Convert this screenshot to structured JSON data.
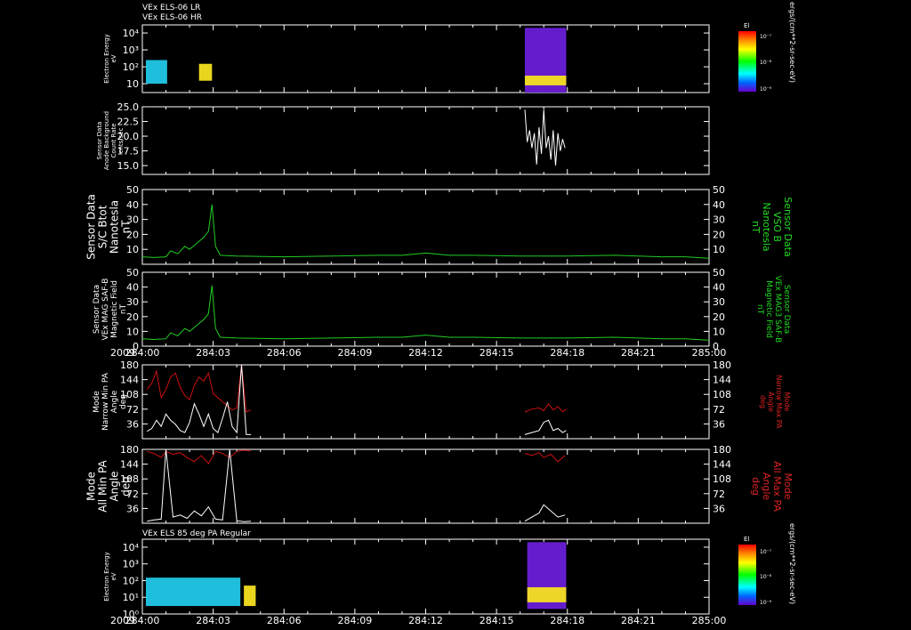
{
  "colors": {
    "background": "#000000",
    "axis": "#ffffff",
    "magnetic": "#22cc22",
    "max_pa": "#cc1111",
    "min_pa": "#ffffff",
    "label_green": "#22dd22",
    "label_red": "#dd2222"
  },
  "header": {
    "line1": "VEx ELS-06 LR",
    "line2": "VEx ELS-06 HR"
  },
  "x_axis": {
    "year": "2009",
    "ticks": [
      "284:00",
      "284:03",
      "284:06",
      "284:09",
      "284:12",
      "284:15",
      "284:18",
      "284:21",
      "285:00"
    ]
  },
  "chart_data": [
    {
      "id": "els_lr_hr",
      "type": "heatmap",
      "ylabel": [
        "Electron Energy",
        "eV"
      ],
      "y_ticks": [
        "10",
        "10²",
        "10³",
        "10⁴"
      ],
      "y_scale": "log",
      "colorbar": {
        "title": "El",
        "ticks": [
          "10⁻⁷",
          "10⁻⁸",
          "10⁻⁹"
        ],
        "unit_label": "ergs/(cm**2-sr-sec-eV)"
      },
      "blocks": [
        {
          "t_start": 0.15,
          "t_end": 1.05,
          "e_low": 10,
          "e_high": 250,
          "level": "mid"
        },
        {
          "t_start": 2.4,
          "t_end": 2.95,
          "e_low": 15,
          "e_high": 150,
          "level": "high"
        },
        {
          "t_start": 16.2,
          "t_end": 17.95,
          "e_low": 3,
          "e_high": 20000,
          "level": "low"
        },
        {
          "t_start": 16.2,
          "t_end": 17.95,
          "e_low": 8,
          "e_high": 30,
          "level": "high"
        }
      ]
    },
    {
      "id": "anode_background",
      "type": "line",
      "ylabel": [
        "Sensor Data",
        "Anode Background",
        "Count Rate",
        "cnts/sec"
      ],
      "ylim": [
        13.5,
        25.0
      ],
      "y_ticks": [
        "15.0",
        "17.5",
        "20.0",
        "22.5",
        "25.0"
      ],
      "y_tick_values": [
        15.0,
        17.5,
        20.0,
        22.5,
        25.0
      ],
      "series": [
        {
          "x": [
            16.2,
            16.3,
            16.4,
            16.5,
            16.6,
            16.7,
            16.8,
            16.9,
            17.0,
            17.1,
            17.2,
            17.3,
            17.4,
            17.5,
            17.6,
            17.7,
            17.8,
            17.9
          ],
          "y": [
            24.5,
            19.0,
            21.0,
            18.0,
            20.5,
            15.2,
            21.5,
            17.0,
            24.5,
            18.0,
            20.0,
            16.0,
            21.0,
            15.0,
            20.5,
            17.5,
            19.5,
            18.0
          ]
        }
      ]
    },
    {
      "id": "sc_bmag",
      "type": "line",
      "ylabel": [
        "Sensor Data",
        "S/C Btot",
        "Nanotesla",
        "nT"
      ],
      "ylabel_right": [
        "Sensor Data",
        "VSO B",
        "Nanotesla",
        "nT"
      ],
      "ylim": [
        0,
        50
      ],
      "y_ticks": [
        "10",
        "20",
        "30",
        "40",
        "50"
      ],
      "y_tick_values": [
        10,
        20,
        30,
        40,
        50
      ],
      "series": [
        {
          "x": [
            0,
            0.5,
            1.0,
            1.2,
            1.5,
            1.8,
            2.0,
            2.3,
            2.6,
            2.8,
            2.95,
            3.1,
            3.3,
            4,
            6,
            8,
            10,
            11,
            12,
            13,
            14,
            16,
            18,
            20,
            22,
            23,
            24
          ],
          "y": [
            5,
            4.5,
            5,
            9,
            7,
            12,
            10,
            14,
            18,
            22,
            40,
            12,
            6,
            5.5,
            5,
            5.5,
            6,
            6,
            7.5,
            6,
            6,
            5.5,
            5.5,
            6,
            5,
            5,
            4
          ]
        }
      ]
    },
    {
      "id": "mag_field",
      "type": "line",
      "ylabel": [
        "Sensor Data",
        "VEx MAG SAF-B",
        "Magnetic Field",
        "nT"
      ],
      "ylabel_right": [
        "Sensor Data",
        "VEx MAG3 SAF-B",
        "Magnetic Field",
        "nT"
      ],
      "ylim": [
        0,
        50
      ],
      "y_ticks": [
        "0",
        "10",
        "20",
        "30",
        "40",
        "50"
      ],
      "y_tick_values": [
        0,
        10,
        20,
        30,
        40,
        50
      ],
      "series": [
        {
          "x": [
            0,
            0.5,
            1.0,
            1.2,
            1.5,
            1.8,
            2.0,
            2.3,
            2.6,
            2.8,
            2.95,
            3.1,
            3.3,
            4,
            6,
            8,
            10,
            11,
            12,
            13,
            14,
            16,
            18,
            20,
            22,
            23,
            24
          ],
          "y": [
            5,
            4.5,
            5,
            9,
            7,
            12,
            10,
            14,
            18,
            22,
            41,
            12,
            6,
            5.5,
            5,
            5.5,
            6,
            6,
            7.5,
            6,
            6,
            5.5,
            5.5,
            6,
            5,
            5,
            4
          ]
        }
      ]
    },
    {
      "id": "narrow_pa",
      "type": "line",
      "ylabel": [
        "Mode",
        "Narrow Min PA",
        "Angle",
        "deg"
      ],
      "ylabel_right": [
        "Mode",
        "Narrow Max PA",
        "Angle",
        "deg"
      ],
      "ylim": [
        0,
        180
      ],
      "y_ticks": [
        "36",
        "72",
        "108",
        "144",
        "180"
      ],
      "y_tick_values": [
        36,
        72,
        108,
        144,
        180
      ],
      "series": [
        {
          "name": "Max PA",
          "x": [
            0.2,
            0.4,
            0.6,
            0.8,
            1.0,
            1.2,
            1.4,
            1.6,
            1.8,
            2.0,
            2.2,
            2.4,
            2.6,
            2.8,
            3.0,
            3.2,
            3.4,
            3.6,
            3.8,
            4.0,
            4.2,
            4.4,
            4.6
          ],
          "y": [
            120,
            135,
            165,
            100,
            120,
            150,
            160,
            125,
            105,
            95,
            130,
            150,
            140,
            160,
            110,
            100,
            90,
            80,
            70,
            75,
            180,
            65,
            70
          ]
        },
        {
          "name": "Max PA",
          "x": [
            16.2,
            16.5,
            16.8,
            17.0,
            17.2,
            17.4,
            17.6,
            17.8,
            17.95
          ],
          "y": [
            65,
            72,
            75,
            68,
            85,
            70,
            78,
            66,
            72
          ]
        },
        {
          "name": "Min PA",
          "x": [
            0.2,
            0.4,
            0.6,
            0.8,
            1.0,
            1.2,
            1.4,
            1.6,
            1.8,
            2.0,
            2.2,
            2.4,
            2.6,
            2.8,
            3.0,
            3.2,
            3.4,
            3.6,
            3.8,
            4.0,
            4.2,
            4.4,
            4.6
          ],
          "y": [
            18,
            25,
            45,
            30,
            60,
            45,
            35,
            20,
            15,
            40,
            85,
            60,
            30,
            60,
            25,
            15,
            50,
            90,
            30,
            15,
            180,
            10,
            10
          ]
        },
        {
          "name": "Min PA",
          "x": [
            16.2,
            16.5,
            16.8,
            17.0,
            17.2,
            17.4,
            17.6,
            17.8,
            17.95
          ],
          "y": [
            10,
            15,
            20,
            40,
            45,
            20,
            25,
            15,
            20
          ]
        }
      ]
    },
    {
      "id": "all_pa",
      "type": "line",
      "ylabel": [
        "Mode",
        "All Min PA",
        "Angle",
        "deg"
      ],
      "ylabel_right": [
        "Mode",
        "All Max PA",
        "Angle",
        "deg"
      ],
      "ylim": [
        0,
        180
      ],
      "y_ticks": [
        "36",
        "72",
        "108",
        "144",
        "180"
      ],
      "y_tick_values": [
        36,
        72,
        108,
        144,
        180
      ],
      "series": [
        {
          "name": "Max PA",
          "x": [
            0.2,
            0.5,
            0.8,
            1.0,
            1.3,
            1.6,
            1.9,
            2.2,
            2.5,
            2.8,
            3.1,
            3.4,
            3.7,
            4.0,
            4.3,
            4.6
          ],
          "y": [
            175,
            170,
            160,
            175,
            168,
            172,
            160,
            150,
            165,
            145,
            175,
            170,
            160,
            175,
            178,
            176
          ]
        },
        {
          "name": "Max PA",
          "x": [
            16.2,
            16.5,
            16.8,
            17.0,
            17.3,
            17.6,
            17.9
          ],
          "y": [
            170,
            165,
            172,
            160,
            168,
            150,
            165
          ]
        },
        {
          "name": "Min PA",
          "x": [
            0.2,
            0.5,
            0.8,
            1.0,
            1.3,
            1.6,
            1.9,
            2.2,
            2.5,
            2.8,
            3.1,
            3.4,
            3.7,
            4.0,
            4.3,
            4.6
          ],
          "y": [
            5,
            8,
            10,
            180,
            15,
            20,
            12,
            30,
            18,
            40,
            10,
            8,
            180,
            6,
            4,
            5
          ]
        },
        {
          "name": "Min PA",
          "x": [
            16.2,
            16.5,
            16.8,
            17.0,
            17.3,
            17.6,
            17.9
          ],
          "y": [
            5,
            15,
            25,
            45,
            30,
            15,
            20
          ]
        }
      ]
    },
    {
      "id": "els_85pa",
      "type": "heatmap",
      "title": "VEx ELS 85 deg PA Regular",
      "ylabel": [
        "Electron Energy",
        "eV"
      ],
      "y_ticks": [
        "10⁰",
        "10¹",
        "10²",
        "10³",
        "10⁴"
      ],
      "y_scale": "log",
      "colorbar": {
        "title": "El",
        "ticks": [
          "10⁻⁷",
          "10⁻⁸",
          "10⁻⁹"
        ],
        "unit_label": "ergs/(cm**2-sr-sec-eV)"
      },
      "blocks": [
        {
          "t_start": 0.15,
          "t_end": 4.15,
          "e_low": 3,
          "e_high": 150,
          "level": "mid"
        },
        {
          "t_start": 4.3,
          "t_end": 4.8,
          "e_low": 3,
          "e_high": 50,
          "level": "high"
        },
        {
          "t_start": 16.3,
          "t_end": 17.95,
          "e_low": 2,
          "e_high": 20000,
          "level": "low"
        },
        {
          "t_start": 16.3,
          "t_end": 17.95,
          "e_low": 5,
          "e_high": 40,
          "level": "high"
        }
      ]
    }
  ]
}
